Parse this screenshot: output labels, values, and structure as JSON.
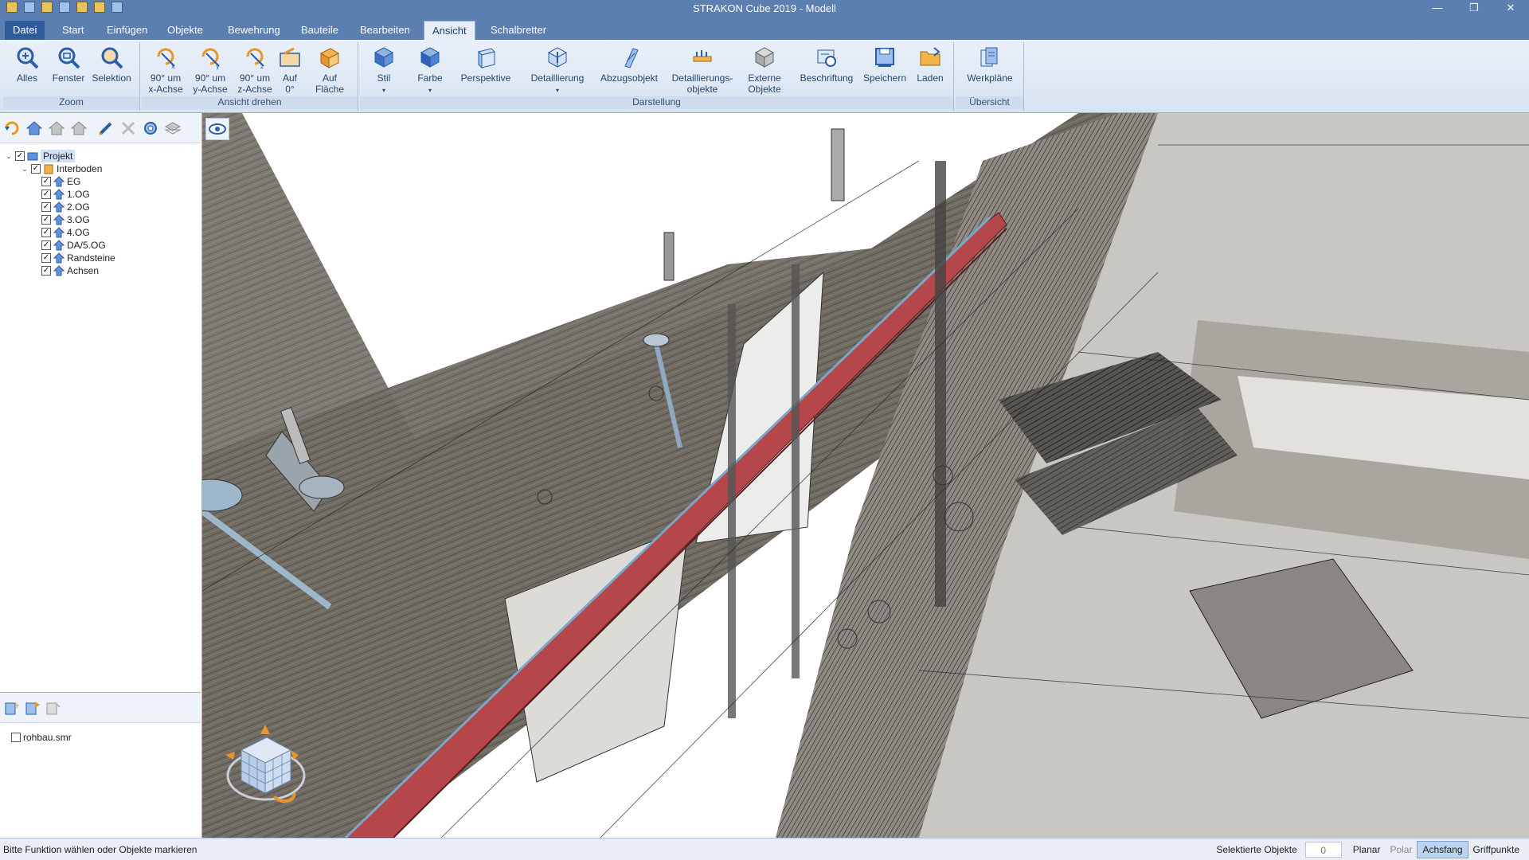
{
  "window": {
    "title": "STRAKON Cube 2019 - Modell",
    "minimize": "—",
    "restore": "❐",
    "close": "✕"
  },
  "ribbon": {
    "tabs": [
      "Datei",
      "Start",
      "Einfügen",
      "Objekte",
      "Bewehrung",
      "Bauteile",
      "Bearbeiten",
      "Ansicht",
      "Schalbretter"
    ],
    "active_tab": "Ansicht",
    "groups": {
      "zoom": {
        "label": "Zoom",
        "buttons": [
          "Alles",
          "Fenster",
          "Selektion"
        ]
      },
      "rotate": {
        "label": "Ansicht drehen",
        "buttons": [
          [
            "90° um",
            "x-Achse"
          ],
          [
            "90° um",
            "y-Achse"
          ],
          [
            "90° um",
            "z-Achse"
          ],
          [
            "Auf",
            "0°"
          ],
          [
            "Auf",
            "Fläche"
          ]
        ]
      },
      "display": {
        "label": "Darstellung",
        "buttons": [
          [
            "Stil",
            "▾"
          ],
          [
            "Farbe",
            "▾"
          ],
          [
            "Perspektive",
            ""
          ],
          [
            "Detaillierung",
            "▾"
          ],
          [
            "Abzugsobjekt",
            ""
          ],
          [
            "Detaillierungs-",
            "objekte"
          ],
          [
            "Externe",
            "Objekte"
          ],
          [
            "Beschriftung",
            ""
          ],
          [
            "Speichern",
            ""
          ],
          [
            "Laden",
            ""
          ]
        ]
      },
      "overview": {
        "label": "Übersicht",
        "buttons": [
          "Werkpläne"
        ]
      }
    }
  },
  "tree": {
    "root": "Projekt",
    "group": "Interboden",
    "items": [
      "EG",
      "1.OG",
      "2.OG",
      "3.OG",
      "4.OG",
      "DA/5.OG",
      "Randsteine",
      "Achsen"
    ]
  },
  "files": {
    "items": [
      "rohbau.smr"
    ]
  },
  "statusbar": {
    "message": "Bitte Funktion wählen oder Objekte markieren",
    "selected_label": "Selektierte Objekte",
    "selected_count": "0",
    "modes": [
      "Planar",
      "Polar",
      "Achsfang",
      "Griffpunkte"
    ],
    "active_mode": "Achsfang"
  },
  "colors": {
    "title_bar": "#5b7fb1",
    "ribbon_bg": "#e9f0f9",
    "beam_red": "#b5474b",
    "floor_grey": "#6f6b63"
  }
}
